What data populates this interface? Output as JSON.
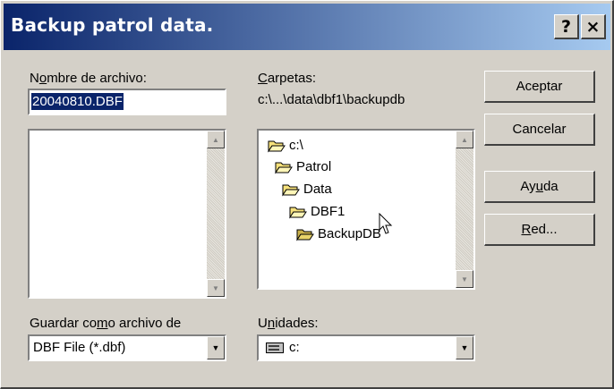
{
  "window": {
    "title": "Backup patrol data.",
    "help_glyph": "?",
    "close_glyph": "×"
  },
  "filename": {
    "label_pre": "N",
    "label_u": "o",
    "label_post": "mbre de archivo:",
    "value": "20040810.DBF"
  },
  "folders": {
    "label_u": "C",
    "label_post": "arpetas:",
    "path": "c:\\...\\data\\dbf1\\backupdb",
    "tree": [
      {
        "label": "c:\\",
        "icon": "open-folder-icon"
      },
      {
        "label": "Patrol",
        "icon": "open-folder-icon"
      },
      {
        "label": "Data",
        "icon": "open-folder-icon"
      },
      {
        "label": "DBF1",
        "icon": "open-folder-icon"
      },
      {
        "label": "BackupDB",
        "icon": "open-folder-icon"
      }
    ]
  },
  "save_as": {
    "label_pre": "Guardar co",
    "label_u": "m",
    "label_post": "o archivo de",
    "value": "DBF File (*.dbf)"
  },
  "drives": {
    "label_pre": "U",
    "label_u": "n",
    "label_post": "idades:",
    "value": "c:",
    "icon": "drive-icon"
  },
  "buttons": {
    "ok": "Aceptar",
    "cancel": "Cancelar",
    "help_pre": "Ay",
    "help_u": "u",
    "help_post": "da",
    "network_u": "R",
    "network_post": "ed..."
  },
  "colors": {
    "title_start": "#0a246a",
    "title_end": "#a6caf0",
    "selection": "#0a246a",
    "face": "#d4d0c8"
  }
}
